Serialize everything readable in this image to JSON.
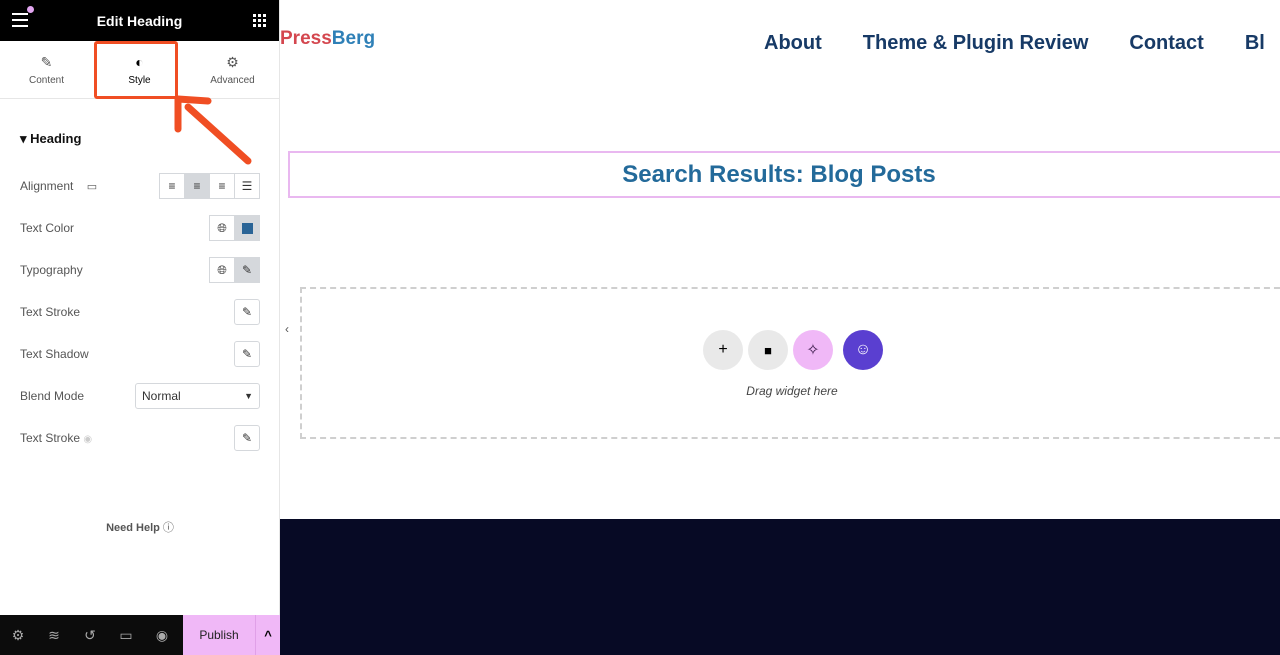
{
  "panel": {
    "title": "Edit Heading",
    "tabs": [
      {
        "label": "Content",
        "icon": "pencil-icon"
      },
      {
        "label": "Style",
        "icon": "contrast-icon"
      },
      {
        "label": "Advanced",
        "icon": "gear-icon"
      }
    ],
    "section": "Heading",
    "controls": {
      "alignment": "Alignment",
      "text_color": "Text Color",
      "typography": "Typography",
      "text_stroke": "Text Stroke",
      "text_shadow": "Text Shadow",
      "blend_mode": "Blend Mode",
      "blend_value": "Normal",
      "text_stroke_2": "Text Stroke"
    },
    "text_color_value": "#2a6496",
    "need_help": "Need Help",
    "publish": "Publish"
  },
  "site": {
    "logo_a": "Press",
    "logo_b": "Berg",
    "nav": [
      "About",
      "Theme & Plugin Review",
      "Contact",
      "Bl"
    ],
    "heading": "Search Results: Blog Posts",
    "drag_text": "Drag widget here"
  },
  "colors": {
    "highlight": "#f04e23",
    "accent": "#f0b8f7",
    "footer": "#070a25"
  }
}
